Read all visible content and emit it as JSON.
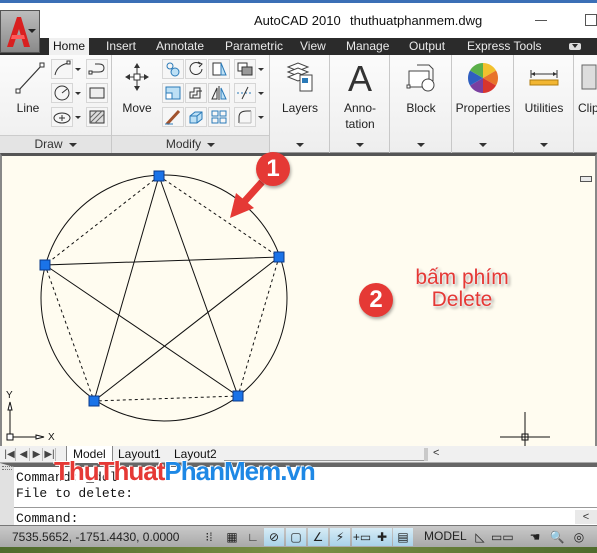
{
  "window": {
    "app_title": "AutoCAD 2010",
    "file_name": "thuthuatphanmem.dwg"
  },
  "ribbon": {
    "tabs": [
      {
        "label": "Home",
        "active": true
      },
      {
        "label": "Insert",
        "active": false
      },
      {
        "label": "Annotate",
        "active": false
      },
      {
        "label": "Parametric",
        "active": false
      },
      {
        "label": "View",
        "active": false
      },
      {
        "label": "Manage",
        "active": false
      },
      {
        "label": "Output",
        "active": false
      },
      {
        "label": "Express Tools",
        "active": false
      }
    ],
    "draw_panel": {
      "title": "Draw",
      "line_label": "Line",
      "tools": [
        "polyline-icon",
        "circle-icon",
        "ellipse-icon",
        "spline-icon",
        "rectangle-icon",
        "hatch-icon"
      ]
    },
    "modify_panel": {
      "title": "Modify",
      "move_label": "Move",
      "tools": [
        "copy-icon",
        "rotate-icon",
        "stretch-icon",
        "draworder-icon",
        "scale-icon",
        "offset-icon",
        "mirror-icon",
        "trim-icon",
        "erase-brush-icon",
        "3dmove-icon",
        "array-icon",
        "fillet-icon"
      ]
    },
    "layers_label": "Layers",
    "annotation_label_1": "Anno-",
    "annotation_label_2": "tation",
    "block_label": "Block",
    "properties_label": "Properties",
    "utilities_label": "Utilities",
    "clipboard_label": "Clip"
  },
  "viewport": {
    "annotation_1": "1",
    "annotation_2": "2",
    "instruction_line1": "bấm phím",
    "instruction_line2": "Delete",
    "ucs_x": "X",
    "ucs_y": "Y",
    "accent_color": "#e53935",
    "grip_color": "#1a73e8"
  },
  "layout_tabs": [
    {
      "label": "Model",
      "active": true
    },
    {
      "label": "Layout1",
      "active": false
    },
    {
      "label": "Layout2",
      "active": false
    }
  ],
  "command": {
    "history_line1": "Command: _del",
    "history_line2": "File to delete:",
    "prompt": "Command:"
  },
  "watermark": {
    "part1": "ThuThuat",
    "part2": "PhanMem",
    "part3": ".vn"
  },
  "status": {
    "coordinates": "7535.5652, -1751.4430, 0.0000",
    "model_label": "MODEL"
  }
}
